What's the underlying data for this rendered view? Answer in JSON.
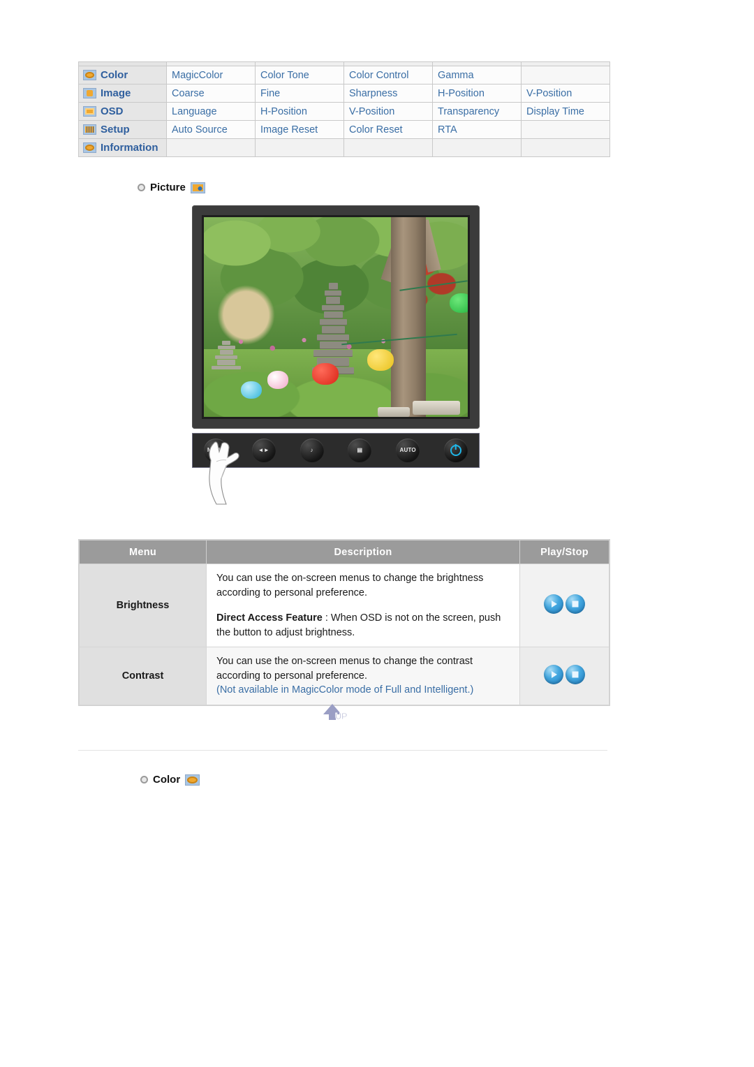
{
  "menu_map": {
    "rows": [
      {
        "icon": "color-icon",
        "category": "Color",
        "items": [
          "MagicColor",
          "Color Tone",
          "Color Control",
          "Gamma",
          ""
        ]
      },
      {
        "icon": "image-icon",
        "category": "Image",
        "items": [
          "Coarse",
          "Fine",
          "Sharpness",
          "H-Position",
          "V-Position"
        ]
      },
      {
        "icon": "osd-icon",
        "category": "OSD",
        "items": [
          "Language",
          "H-Position",
          "V-Position",
          "Transparency",
          "Display Time"
        ]
      },
      {
        "icon": "setup-icon",
        "category": "Setup",
        "items": [
          "Auto Source",
          "Image Reset",
          "Color Reset",
          "RTA",
          ""
        ]
      },
      {
        "icon": "information-icon",
        "category": "Information",
        "items": [
          "",
          "",
          "",
          "",
          ""
        ]
      }
    ]
  },
  "sections": {
    "picture": {
      "label": "Picture",
      "badge_icon": "picture-badge-icon"
    },
    "color": {
      "label": "Color",
      "badge_icon": "color-badge-icon"
    }
  },
  "monitor": {
    "alt": "Monitor displaying a garden scene with stone pagoda, trees and colorful lanterns",
    "controls": [
      {
        "name": "menu-button",
        "glyph": "MENU"
      },
      {
        "name": "brightness-down-button",
        "glyph": "◄►"
      },
      {
        "name": "volume-button",
        "glyph": "♪"
      },
      {
        "name": "enter-button",
        "glyph": "▤"
      },
      {
        "name": "auto-button",
        "glyph": "AUTO"
      },
      {
        "name": "power-button",
        "glyph": "power"
      }
    ]
  },
  "desc_table": {
    "headers": [
      "Menu",
      "Description",
      "Play/Stop"
    ],
    "rows": [
      {
        "menu": "Brightness",
        "paragraphs": [
          {
            "lead": "",
            "text": "You can use the on-screen menus to change the brightness according to personal preference."
          },
          {
            "lead": "Direct Access Feature",
            "text": " : When OSD is not on the screen, push the button to adjust brightness."
          }
        ],
        "note": "",
        "play_label": "play-icon",
        "stop_label": "stop-icon"
      },
      {
        "menu": "Contrast",
        "paragraphs": [
          {
            "lead": "",
            "text": "You can use the on-screen menus to change the contrast according to personal preference."
          }
        ],
        "note": "(Not available in MagicColor mode of Full and Intelligent.)",
        "play_label": "play-icon",
        "stop_label": "stop-icon"
      }
    ]
  },
  "up_button": {
    "label": "UP"
  },
  "colors": {
    "link_blue": "#3a6ea5",
    "header_gray": "#9b9b9b",
    "menu_cell_gray": "#e0e0e0",
    "category_gray": "#e6e6e6",
    "icon_orange": "#f0a830",
    "icon_blue_bg": "#a8c6e4",
    "power_cyan": "#1fb6e8"
  }
}
